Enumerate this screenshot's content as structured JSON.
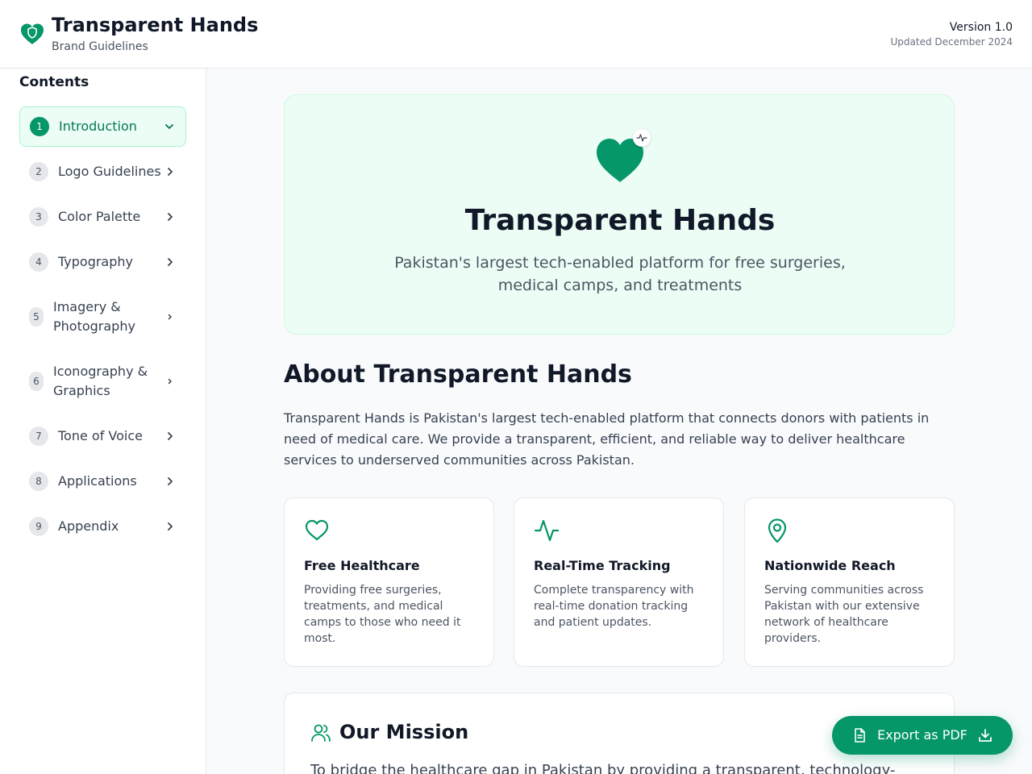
{
  "header": {
    "title": "Transparent Hands",
    "subtitle": "Brand Guidelines",
    "version": "Version 1.0",
    "updated": "Updated December 2024"
  },
  "sidebar": {
    "title": "Contents",
    "items": [
      {
        "num": "1",
        "label": "Introduction",
        "active": true,
        "icon": "chevron-down-icon"
      },
      {
        "num": "2",
        "label": "Logo Guidelines",
        "active": false,
        "icon": "chevron-right-icon"
      },
      {
        "num": "3",
        "label": "Color Palette",
        "active": false,
        "icon": "chevron-right-icon"
      },
      {
        "num": "4",
        "label": "Typography",
        "active": false,
        "icon": "chevron-right-icon"
      },
      {
        "num": "5",
        "label": "Imagery & Photography",
        "active": false,
        "icon": "chevron-right-icon"
      },
      {
        "num": "6",
        "label": "Iconography & Graphics",
        "active": false,
        "icon": "chevron-right-icon"
      },
      {
        "num": "7",
        "label": "Tone of Voice",
        "active": false,
        "icon": "chevron-right-icon"
      },
      {
        "num": "8",
        "label": "Applications",
        "active": false,
        "icon": "chevron-right-icon"
      },
      {
        "num": "9",
        "label": "Appendix",
        "active": false,
        "icon": "chevron-right-icon"
      }
    ]
  },
  "hero": {
    "title": "Transparent Hands",
    "subtitle": "Pakistan's largest tech-enabled platform for free surgeries, medical camps, and treatments",
    "icon": "heart-icon",
    "badge_icon": "activity-icon"
  },
  "about": {
    "title": "About Transparent Hands",
    "body": "Transparent Hands is Pakistan's largest tech-enabled platform that connects donors with patients in need of medical care. We provide a transparent, efficient, and reliable way to deliver healthcare services to underserved communities across Pakistan."
  },
  "features": [
    {
      "icon": "heart-icon",
      "title": "Free Healthcare",
      "description": "Providing free surgeries, treatments, and medical camps to those who need it most."
    },
    {
      "icon": "activity-icon",
      "title": "Real-Time Tracking",
      "description": "Complete transparency with real-time donation tracking and patient updates."
    },
    {
      "icon": "map-pin-icon",
      "title": "Nationwide Reach",
      "description": "Serving communities across Pakistan with our extensive network of healthcare providers."
    }
  ],
  "mission": {
    "icon": "users-icon",
    "title": "Our Mission",
    "body": "To bridge the healthcare gap in Pakistan by providing a transparent, technology-"
  },
  "export": {
    "label": "Export as PDF",
    "icon": "file-text-icon",
    "trailing_icon": "download-icon"
  },
  "colors": {
    "brand": "#059669",
    "brand_light": "#ecfdf5",
    "text": "#111827",
    "muted": "#4b5563"
  }
}
